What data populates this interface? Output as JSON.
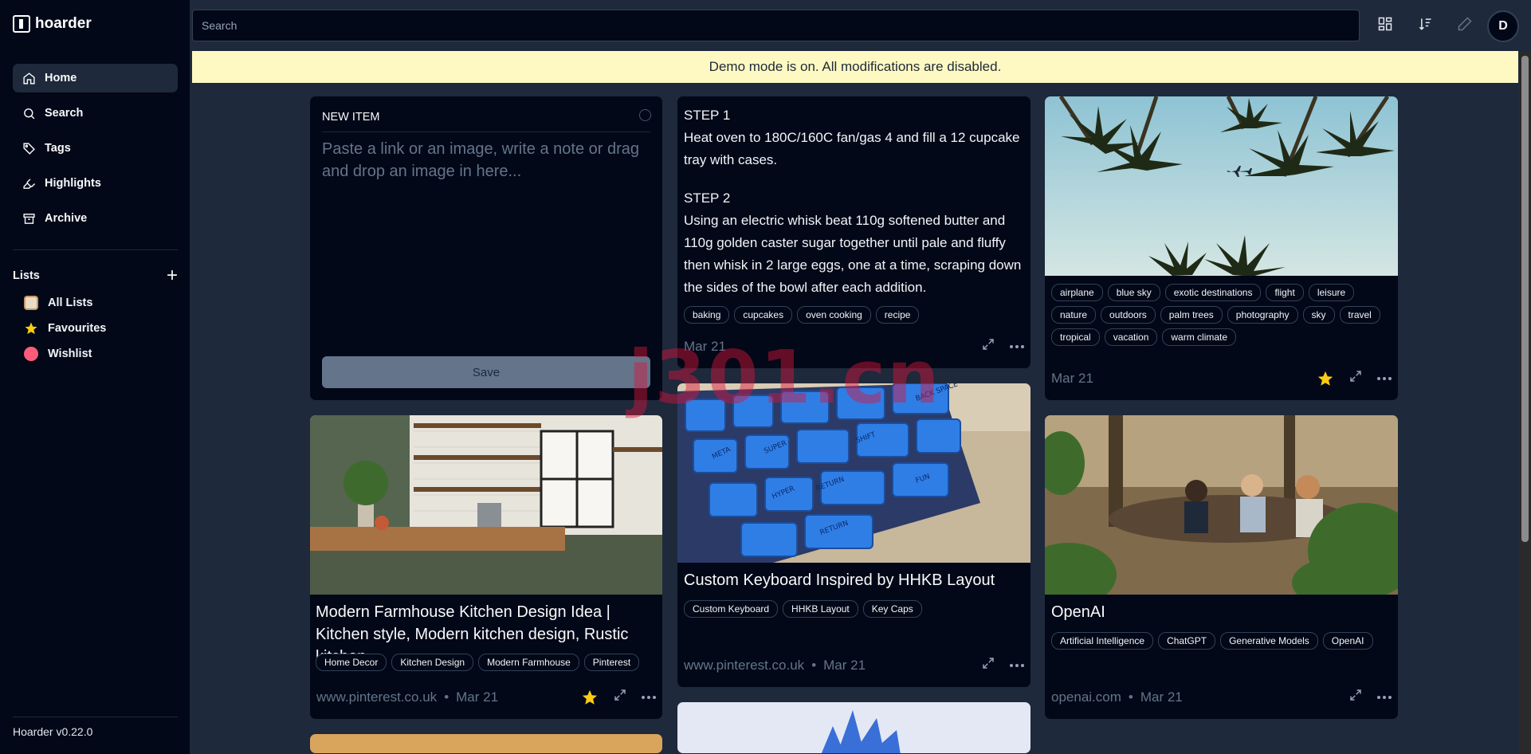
{
  "app": {
    "name": "hoarder",
    "version": "Hoarder v0.22.0"
  },
  "sidebar": {
    "nav": [
      {
        "label": "Home"
      },
      {
        "label": "Search"
      },
      {
        "label": "Tags"
      },
      {
        "label": "Highlights"
      },
      {
        "label": "Archive"
      }
    ],
    "lists_title": "Lists",
    "lists": [
      {
        "label": "All Lists",
        "icon": "clipboard-icon"
      },
      {
        "label": "Favourites",
        "icon": "star-icon"
      },
      {
        "label": "Wishlist",
        "icon": "heart-eyes-icon"
      }
    ]
  },
  "topbar": {
    "search_placeholder": "Search",
    "avatar_initial": "D"
  },
  "banner": "Demo mode is on. All modifications are disabled.",
  "new_item": {
    "title": "NEW ITEM",
    "placeholder": "Paste a link or an image, write a note or drag and drop an image in here...",
    "save_label": "Save"
  },
  "recipe_card": {
    "step1_title": "STEP 1",
    "step1_text": "Heat oven to 180C/160C fan/gas 4 and fill a 12 cupcake tray with cases.",
    "step2_title": "STEP 2",
    "step2_text": "Using an electric whisk beat 110g softened butter and 110g golden caster sugar together until pale and fluffy then whisk in 2 large eggs, one at a time, scraping down the sides of the bowl after each addition.",
    "tags": [
      "baking",
      "cupcakes",
      "oven cooking",
      "recipe"
    ],
    "date": "Mar 21"
  },
  "palm_card": {
    "tags": [
      "airplane",
      "blue sky",
      "exotic destinations",
      "flight",
      "leisure",
      "nature",
      "outdoors",
      "palm trees",
      "photography",
      "sky",
      "travel",
      "tropical",
      "vacation",
      "warm climate"
    ],
    "date": "Mar 21",
    "favourite": true
  },
  "keyboard_card": {
    "title": "Custom Keyboard Inspired by HHKB Layout",
    "tags": [
      "Custom Keyboard",
      "HHKB Layout",
      "Key Caps"
    ],
    "source": "www.pinterest.co.uk",
    "date": "Mar 21",
    "keycap_labels": [
      "RETURN",
      "SHIFT",
      "FUN",
      "BACK SPACE",
      "RETURN",
      "META",
      "SUPER",
      "HYPER"
    ]
  },
  "kitchen_card": {
    "title": "Modern Farmhouse Kitchen Design Idea | Kitchen style, Modern kitchen design, Rustic kitchen",
    "tags": [
      "Home Decor",
      "Kitchen Design",
      "Modern Farmhouse",
      "Pinterest"
    ],
    "source": "www.pinterest.co.uk",
    "date": "Mar 21",
    "favourite": true
  },
  "openai_card": {
    "title": "OpenAI",
    "tags": [
      "Artificial Intelligence",
      "ChatGPT",
      "Generative Models",
      "OpenAI"
    ],
    "source": "openai.com",
    "date": "Mar 21"
  },
  "watermark": "j301.cn",
  "colors": {
    "background": "#1e293b",
    "panel": "#020817",
    "banner": "#fef9c3",
    "star": "#facc15"
  }
}
